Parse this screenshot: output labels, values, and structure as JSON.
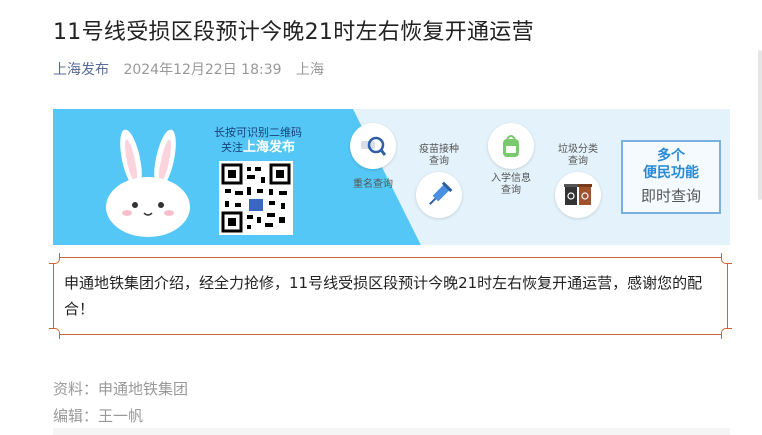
{
  "article": {
    "title": "11号线受损区段预计今晚21时左右恢复开通运营",
    "source": "上海发布",
    "date": "2024年12月22日 18:39",
    "location": "上海"
  },
  "banner": {
    "qr_caption_line1": "长按可识别二维码",
    "qr_caption_line2_prefix": "关注",
    "qr_caption_brand": "上海发布",
    "functions": [
      {
        "label": "重名查询",
        "icon": "magnifier-icon"
      },
      {
        "label": "疫苗接种\n查询",
        "icon": "syringe-icon"
      },
      {
        "label": "入学信息\n查询",
        "icon": "backpack-icon"
      },
      {
        "label": "垃圾分类\n查询",
        "icon": "trash-bin-icon"
      }
    ],
    "more_line1": "多个",
    "more_line2": "便民功能",
    "more_line3": "即时查询"
  },
  "notice": {
    "text": "申通地铁集团介绍，经全力抢修，11号线受损区段预计今晚21时左右恢复开通运营，感谢您的配合！"
  },
  "credits": {
    "source": "资料：申通地铁集团",
    "editor": "编辑：王一帆"
  },
  "colors": {
    "banner_blue": "#55c7f6",
    "accent_border": "#c9662f",
    "source_link": "#576b95"
  }
}
